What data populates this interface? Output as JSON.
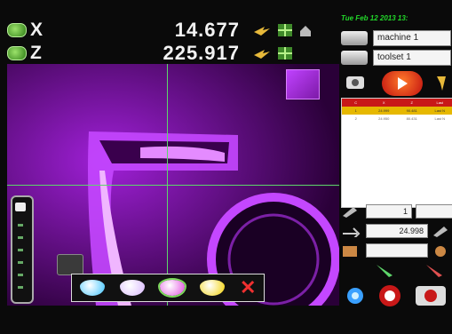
{
  "readouts": {
    "x": {
      "label": "X",
      "value": "14.677"
    },
    "z": {
      "label": "Z",
      "value": "225.917"
    }
  },
  "panel": {
    "date": "Tue Feb 12 2013 13:",
    "machine": "machine 1",
    "toolset": "toolset 1",
    "table": {
      "headers": [
        "C",
        "X",
        "Z",
        "Last"
      ],
      "rows": [
        [
          "1",
          "24.999",
          "90.481",
          "Last N"
        ],
        [
          "2",
          "24.950",
          "80.431",
          "Last N"
        ]
      ],
      "selected_row": 0
    },
    "field_a": "1",
    "field_b": "24.998"
  },
  "colors": {
    "camera_bg": "#230032",
    "crosshair": "#5ed66b",
    "accent_red": "#c81818",
    "highlight": "#e6b800"
  },
  "color_toolbar": {
    "swatches": [
      "#3cc3ff",
      "#d8b7ff",
      "#e04ce0",
      "#f2d000"
    ]
  }
}
